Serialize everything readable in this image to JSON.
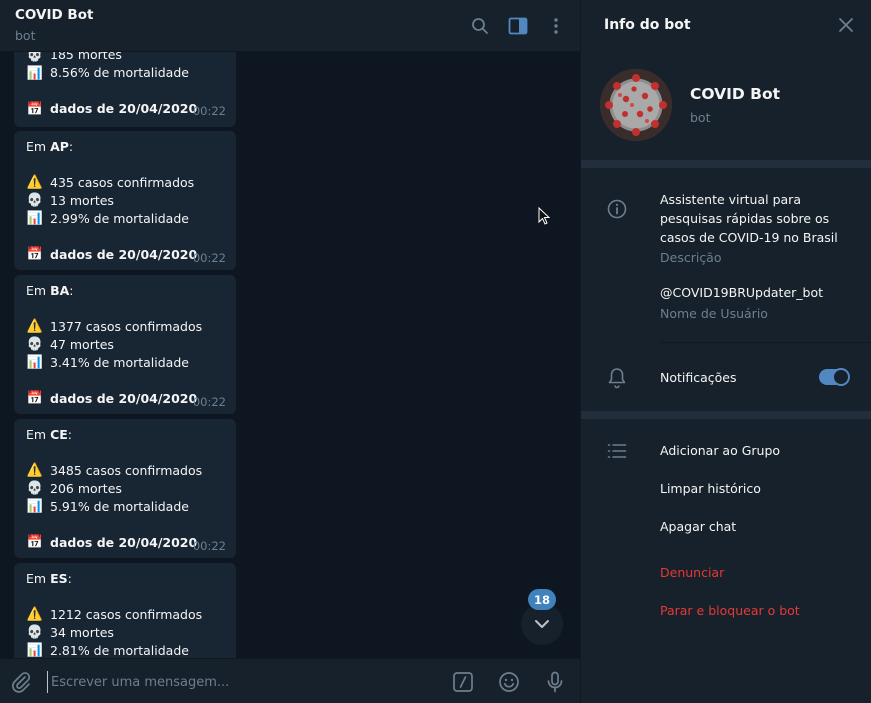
{
  "chat": {
    "title": "COVID Bot",
    "subtitle": "bot",
    "composer_placeholder": "Escrever uma mensagem...",
    "unread_count": "18"
  },
  "messages": [
    {
      "state": "",
      "cases": "",
      "deaths": "185 mortes",
      "mortality": "8.56% de mortalidade",
      "date": "dados de 20/04/2020",
      "time": "00:22"
    },
    {
      "prefix": "Em",
      "state": "AP",
      "cases": "435 casos confirmados",
      "deaths": "13 mortes",
      "mortality": "2.99% de mortalidade",
      "date": "dados de 20/04/2020",
      "time": "00:22"
    },
    {
      "prefix": "Em",
      "state": "BA",
      "cases": "1377 casos confirmados",
      "deaths": "47 mortes",
      "mortality": "3.41% de mortalidade",
      "date": "dados de 20/04/2020",
      "time": "00:22"
    },
    {
      "prefix": "Em",
      "state": "CE",
      "cases": "3485 casos confirmados",
      "deaths": "206 mortes",
      "mortality": "5.91% de mortalidade",
      "date": "dados de 20/04/2020",
      "time": "00:22"
    },
    {
      "prefix": "Em",
      "state": "ES",
      "cases": "1212 casos confirmados",
      "deaths": "34 mortes",
      "mortality": "2.81% de mortalidade"
    }
  ],
  "panel": {
    "title": "Info do bot",
    "bot_name": "COVID Bot",
    "bot_sub": "bot",
    "description": "Assistente virtual para pesquisas rápidas sobre os casos de COVID-19 no Brasil",
    "description_label": "Descrição",
    "username": "@COVID19BRUpdater_bot",
    "username_label": "Nome de Usuário",
    "notifications_label": "Notificações",
    "notifications_on": true,
    "actions": [
      "Adicionar ao Grupo",
      "Limpar histórico",
      "Apagar chat"
    ],
    "danger_actions": [
      "Denunciar",
      "Parar e bloquear o bot"
    ]
  },
  "colors": {
    "background": "#0e1621",
    "sidebar": "#17212b",
    "bubble": "#182533",
    "accent": "#5288c1",
    "danger": "#e53935",
    "muted": "#6d7f8f"
  },
  "icons": [
    "search-icon",
    "sidebar-toggle-icon",
    "more-vertical-icon",
    "close-icon",
    "info-icon",
    "bell-icon",
    "list-icon",
    "attach-icon",
    "bot-command-icon",
    "emoji-icon",
    "mic-icon",
    "chevron-down-icon",
    "skull-emoji",
    "warning-emoji",
    "chart-emoji",
    "calendar-emoji"
  ]
}
